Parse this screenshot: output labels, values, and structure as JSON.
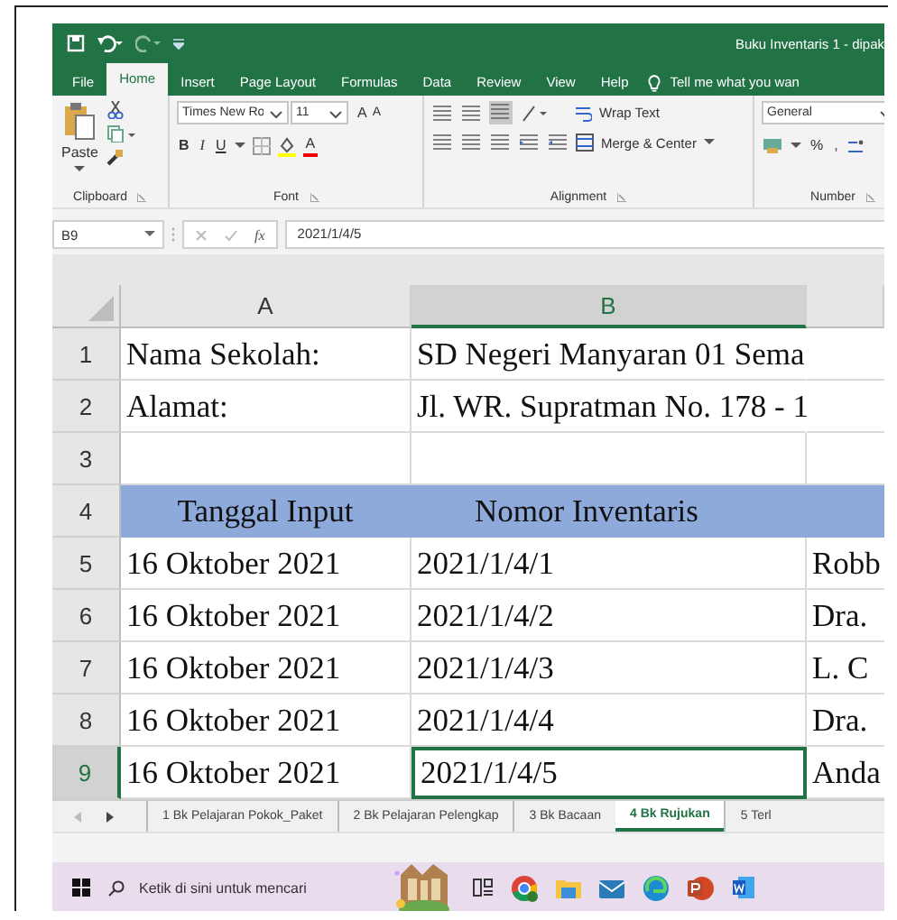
{
  "window": {
    "title": "Buku Inventaris 1 - dipak"
  },
  "menu_tabs": [
    {
      "label": "File",
      "selected": false
    },
    {
      "label": "Home",
      "selected": true
    },
    {
      "label": "Insert",
      "selected": false
    },
    {
      "label": "Page Layout",
      "selected": false
    },
    {
      "label": "Formulas",
      "selected": false
    },
    {
      "label": "Data",
      "selected": false
    },
    {
      "label": "Review",
      "selected": false
    },
    {
      "label": "View",
      "selected": false
    },
    {
      "label": "Help",
      "selected": false
    }
  ],
  "tell_me": "Tell me what you wan",
  "ribbon": {
    "clipboard": {
      "paste": "Paste",
      "label": "Clipboard"
    },
    "font": {
      "name": "Times New Ro",
      "size": "11",
      "grow": "A",
      "shrink": "A",
      "bold": "B",
      "italic": "I",
      "underline": "U",
      "font_color": "A",
      "label": "Font"
    },
    "alignment": {
      "wrap": "Wrap Text",
      "merge": "Merge & Center",
      "label": "Alignment"
    },
    "number": {
      "format": "General",
      "percent": "%",
      "comma": ",",
      "label": "Number"
    }
  },
  "formula_bar": {
    "name_box": "B9",
    "fx": "fx",
    "value": "2021/1/4/5"
  },
  "columns": [
    {
      "label": "A",
      "selected": false
    },
    {
      "label": "B",
      "selected": true
    }
  ],
  "rows": [
    {
      "number": "1",
      "kind": "info",
      "selected": false,
      "cells": [
        "Nama Sekolah:",
        "SD Negeri Manyaran 01 Sema"
      ]
    },
    {
      "number": "2",
      "kind": "info",
      "selected": false,
      "cells": [
        "Alamat:",
        "Jl. WR. Supratman No. 178 - 1"
      ]
    },
    {
      "number": "3",
      "kind": "blank",
      "selected": false
    },
    {
      "number": "4",
      "kind": "header",
      "selected": false,
      "cells": [
        "Tanggal Input",
        "Nomor Inventaris"
      ]
    },
    {
      "number": "5",
      "kind": "data",
      "selected": false,
      "cells": [
        "16 Oktober 2021",
        "2021/1/4/1",
        "Robb"
      ]
    },
    {
      "number": "6",
      "kind": "data",
      "selected": false,
      "cells": [
        "16 Oktober 2021",
        "2021/1/4/2",
        "Dra."
      ]
    },
    {
      "number": "7",
      "kind": "data",
      "selected": false,
      "cells": [
        "16 Oktober 2021",
        "2021/1/4/3",
        "L. C"
      ]
    },
    {
      "number": "8",
      "kind": "data",
      "selected": false,
      "cells": [
        "16 Oktober 2021",
        "2021/1/4/4",
        "Dra."
      ]
    },
    {
      "number": "9",
      "kind": "data",
      "selected": true,
      "cells": [
        "16 Oktober 2021",
        "2021/1/4/5",
        "Anda"
      ]
    }
  ],
  "sheet_tabs": [
    {
      "label": "1 Bk Pelajaran Pokok_Paket",
      "selected": false
    },
    {
      "label": "2 Bk Pelajaran Pelengkap",
      "selected": false
    },
    {
      "label": "3 Bk Bacaan",
      "selected": false
    },
    {
      "label": "4 Bk Rujukan",
      "selected": true
    },
    {
      "label": "5 Terl",
      "selected": false
    }
  ],
  "taskbar": {
    "search": {
      "placeholder": "Ketik di sini untuk mencari"
    }
  }
}
